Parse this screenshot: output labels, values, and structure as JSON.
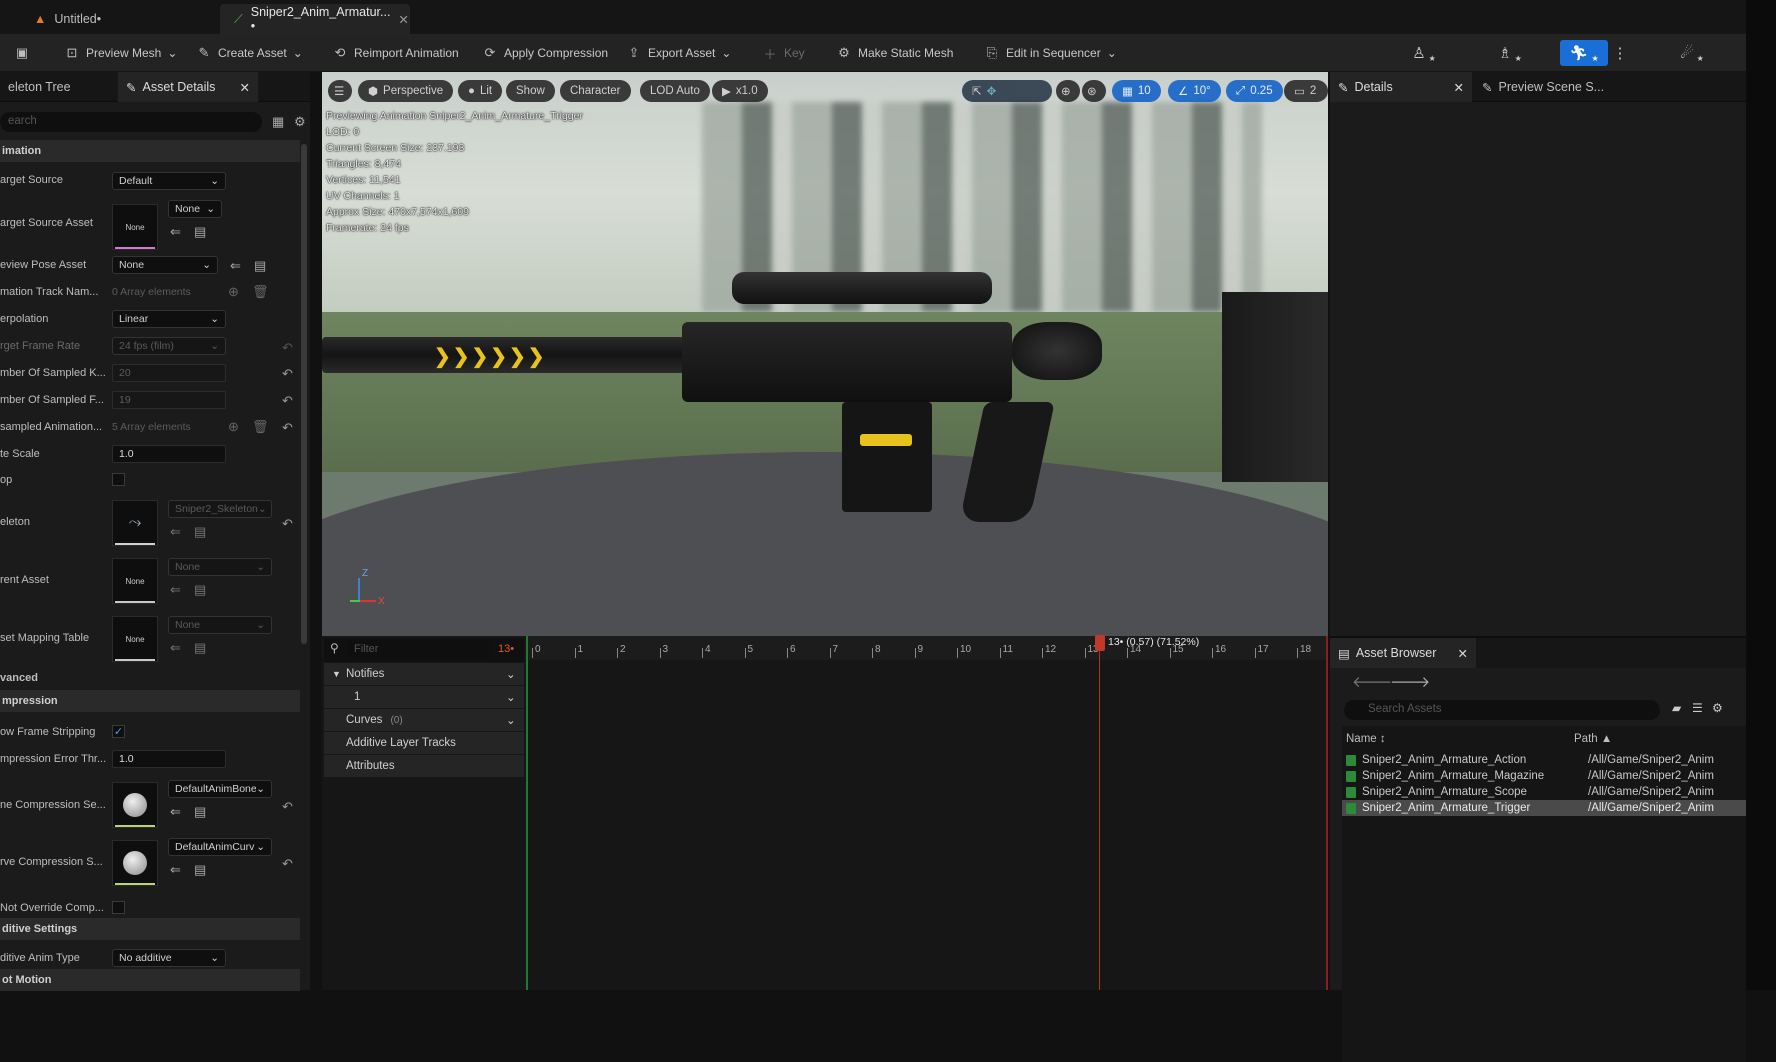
{
  "tabs": [
    {
      "label": "Untitled•"
    },
    {
      "label": "Sniper2_Anim_Armatur... •"
    }
  ],
  "toolbar": {
    "preview_mesh": "Preview Mesh",
    "create_asset": "Create Asset",
    "reimport": "Reimport Animation",
    "apply_compression": "Apply Compression",
    "export_asset": "Export Asset",
    "key": "Key",
    "make_static_mesh": "Make Static Mesh",
    "edit_in_sequencer": "Edit in Sequencer"
  },
  "left": {
    "tab_skeleton": "eleton Tree",
    "tab_asset": "Asset Details",
    "search_placeholder": "earch",
    "sections": {
      "animation": "imation",
      "advanced": "vanced",
      "compression": "mpression",
      "additive": "ditive Settings",
      "root": "ot Motion"
    },
    "props": [
      {
        "label": "arget Source",
        "value": "Default"
      },
      {
        "label": "arget Source Asset",
        "value": "None",
        "thumb": "None"
      },
      {
        "label": "eview Pose Asset",
        "value": "None"
      },
      {
        "label": "mation Track Nam...",
        "value": "0 Array elements"
      },
      {
        "label": "erpolation",
        "value": "Linear"
      },
      {
        "label": "rget Frame Rate",
        "value": "24 fps (film)"
      },
      {
        "label": "mber Of Sampled K...",
        "value": "20"
      },
      {
        "label": "mber Of Sampled F...",
        "value": "19"
      },
      {
        "label": "sampled Animation...",
        "value": "5 Array elements"
      },
      {
        "label": "te Scale",
        "value": "1.0"
      },
      {
        "label": "op",
        "value": ""
      },
      {
        "label": "eleton",
        "value": "Sniper2_Skeleton"
      },
      {
        "label": "rent Asset",
        "value": "None",
        "thumb": "None"
      },
      {
        "label": "set Mapping Table",
        "value": "None",
        "thumb": "None"
      },
      {
        "label": "ow Frame Stripping",
        "value": "✓"
      },
      {
        "label": "mpression Error Thr...",
        "value": "1.0"
      },
      {
        "label": "ne Compression Se...",
        "value": "DefaultAnimBone"
      },
      {
        "label": "rve Compression S...",
        "value": "DefaultAnimCurv"
      },
      {
        "label": "Not Override Comp...",
        "value": ""
      },
      {
        "label": "ditive Anim Type",
        "value": "No additive"
      }
    ]
  },
  "viewport": {
    "buttons": {
      "perspective": "Perspective",
      "lit": "Lit",
      "show": "Show",
      "character": "Character",
      "lod": "LOD Auto",
      "play": "x1.0",
      "grid": "10",
      "angle": "10°",
      "scale": "0.25",
      "cam": "2"
    },
    "info": [
      "Previewing Animation Sniper2_Anim_Armature_Trigger",
      "LOD: 0",
      "Current Screen Size: 237.193",
      "Triangles: 8,474",
      "Vertices: 11,541",
      "UV Channels: 1",
      "Approx Size: 470x7,574x1,609",
      "Framerate: 24 fps"
    ],
    "axis": {
      "z": "Z",
      "x": "X"
    }
  },
  "timeline": {
    "filter_placeholder": "Filter",
    "frame": "13•",
    "playhead": "13• (0.57) (71.52%)",
    "ticks": [
      "0",
      "1",
      "2",
      "3",
      "4",
      "5",
      "6",
      "7",
      "8",
      "9",
      "10",
      "11",
      "12",
      "13",
      "14",
      "15",
      "16",
      "17",
      "18"
    ],
    "tracks": {
      "notifies": "Notifies",
      "track1": "1",
      "curves": "Curves",
      "curves_count": "(0)",
      "additive": "Additive Layer Tracks",
      "attributes": "Attributes"
    }
  },
  "right": {
    "tab_details": "Details",
    "tab_preview": "Preview Scene S...",
    "tab_browser": "Asset Browser",
    "search_placeholder": "Search Assets",
    "col_name": "Name",
    "col_path": "Path",
    "assets": [
      {
        "name": "Sniper2_Anim_Armature_Action",
        "path": "/All/Game/Sniper2_Anim"
      },
      {
        "name": "Sniper2_Anim_Armature_Magazine",
        "path": "/All/Game/Sniper2_Anim"
      },
      {
        "name": "Sniper2_Anim_Armature_Scope",
        "path": "/All/Game/Sniper2_Anim"
      },
      {
        "name": "Sniper2_Anim_Armature_Trigger",
        "path": "/All/Game/Sniper2_Anim"
      }
    ]
  },
  "colors": {
    "accent": "#1a6fd6",
    "playhead": "#c0392b",
    "stripe": "#e8c21c"
  }
}
